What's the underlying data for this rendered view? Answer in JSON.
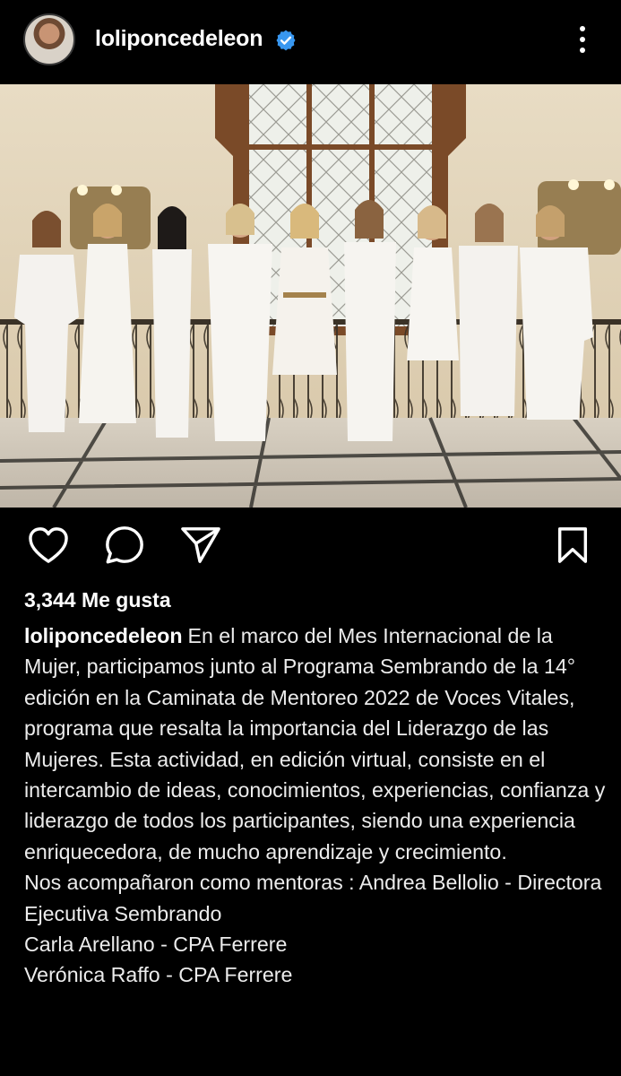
{
  "post": {
    "username": "loliponcedeleon",
    "verified": true,
    "likes_text": "3,344 Me gusta",
    "caption_author": "loliponcedeleon",
    "caption_body": "En el marco del Mes Internacional de la Mujer, participamos junto al Programa Sembrando de la 14° edición en la Caminata de Mentoreo 2022 de Voces Vitales, programa que resalta la importancia del Liderazgo de las Mujeres.  Esta actividad, en edición virtual, consiste en el intercambio de ideas, conocimientos, experiencias, confianza y liderazgo de todos los participantes, siendo una experiencia enriquecedora, de mucho aprendizaje y crecimiento.",
    "caption_lines": [
      "Nos acompañaron como mentoras : Andrea Bellolio - Directora Ejecutiva Sembrando",
      "Carla Arellano - CPA Ferrere",
      "Verónica Raffo - CPA Ferrere"
    ]
  },
  "icons": {
    "like": "heart-icon",
    "comment": "comment-bubble-icon",
    "share": "paper-plane-icon",
    "save": "bookmark-icon",
    "more": "vertical-dots-icon",
    "verified": "verified-badge-icon"
  },
  "colors": {
    "background": "#000000",
    "text": "#ececec",
    "verified_blue": "#3897f0"
  }
}
